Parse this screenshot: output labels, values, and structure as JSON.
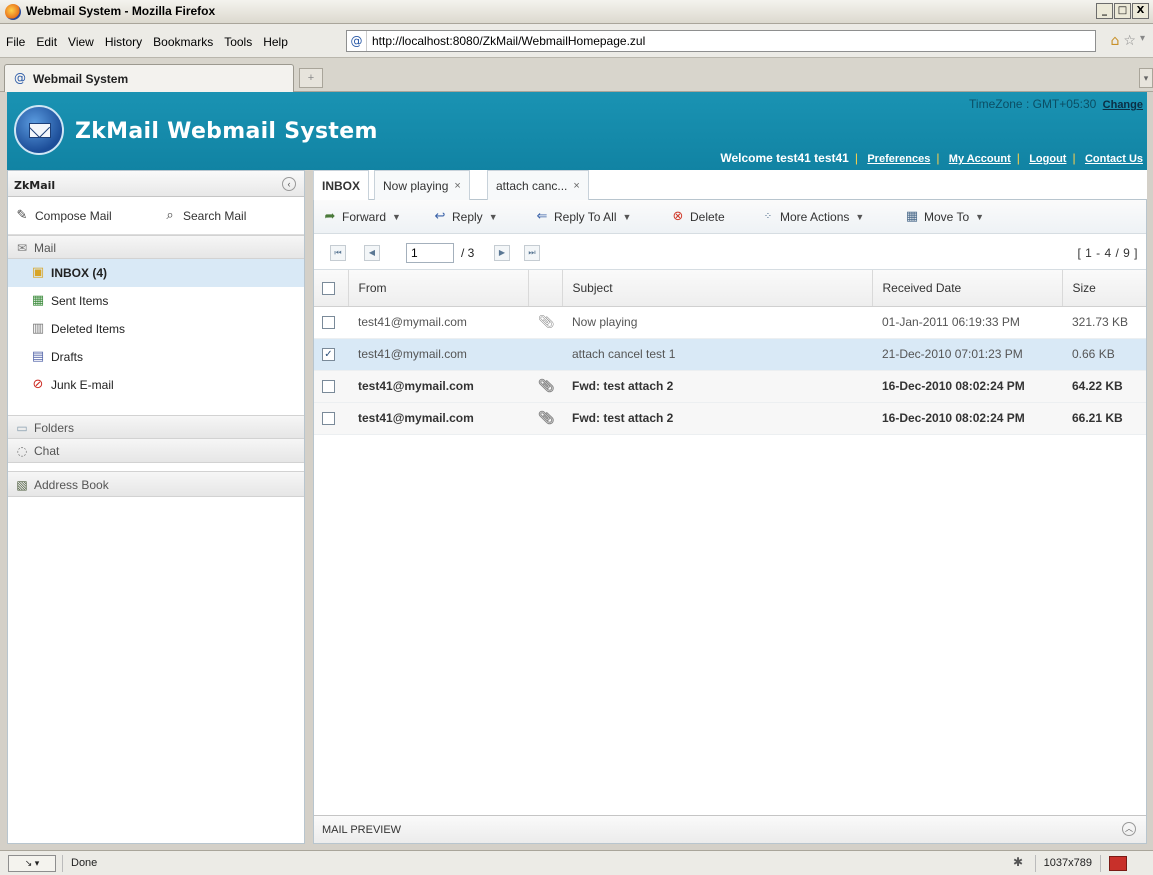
{
  "window": {
    "title": "Webmail System - Mozilla Firefox",
    "controls": [
      "_",
      "□",
      "X"
    ]
  },
  "browser": {
    "menu": [
      "File",
      "Edit",
      "View",
      "History",
      "Bookmarks",
      "Tools",
      "Help"
    ],
    "url": "http://localhost:8080/ZkMail/WebmailHomepage.zul",
    "tab_title": "Webmail System",
    "status": "Done",
    "resolution": "1037x789"
  },
  "app": {
    "title": "ZkMail Webmail System",
    "timezone_label": "TimeZone : GMT+05:30",
    "timezone_change": "Change",
    "welcome": "Welcome test41 test41",
    "links": [
      "Preferences",
      "My Account",
      "Logout",
      "Contact Us"
    ]
  },
  "sidebar": {
    "header": "ZkMail",
    "compose_label": "Compose Mail",
    "search_label": "Search Mail",
    "mail_group": "Mail",
    "folders": [
      {
        "label": "INBOX (4)",
        "icon": "inbox-icon",
        "selected": true
      },
      {
        "label": "Sent Items",
        "icon": "sent-icon"
      },
      {
        "label": "Deleted Items",
        "icon": "trash-icon"
      },
      {
        "label": "Drafts",
        "icon": "drafts-icon"
      },
      {
        "label": "Junk E-mail",
        "icon": "junk-icon"
      }
    ],
    "folders_group": "Folders",
    "chat_group": "Chat",
    "address_book": "Address Book"
  },
  "main": {
    "tabs": [
      {
        "label": "INBOX",
        "closable": false,
        "active": true
      },
      {
        "label": "Now playing",
        "closable": true
      },
      {
        "label": "attach canc...",
        "closable": true
      }
    ],
    "toolbar": {
      "forward": "Forward",
      "reply": "Reply",
      "reply_all": "Reply To All",
      "delete": "Delete",
      "more_actions": "More Actions",
      "move_to": "Move To"
    },
    "pager": {
      "page": "1",
      "total": "/ 3",
      "range": "[ 1 - 4 / 9 ]"
    },
    "columns": [
      "From",
      "Subject",
      "Received Date",
      "Size"
    ],
    "rows": [
      {
        "from": "test41@mymail.com",
        "attachment": true,
        "subject": "Now playing",
        "date": "01-Jan-2011 06:19:33 PM",
        "size": "321.73 KB",
        "checked": false,
        "unread": false,
        "selected": false
      },
      {
        "from": "test41@mymail.com",
        "attachment": false,
        "subject": "attach cancel test 1",
        "date": "21-Dec-2010 07:01:23 PM",
        "size": "0.66 KB",
        "checked": true,
        "unread": false,
        "selected": true
      },
      {
        "from": "test41@mymail.com",
        "attachment": true,
        "subject": "Fwd: test attach 2",
        "date": "16-Dec-2010 08:02:24 PM",
        "size": "64.22 KB",
        "checked": false,
        "unread": true,
        "selected": false
      },
      {
        "from": "test41@mymail.com",
        "attachment": true,
        "subject": "Fwd: test attach 2",
        "date": "16-Dec-2010 08:02:24 PM",
        "size": "66.21 KB",
        "checked": false,
        "unread": true,
        "selected": false
      }
    ],
    "preview_label": "MAIL PREVIEW"
  },
  "colors": {
    "header_bg": "#1a93b3",
    "selection": "#d9e9f6",
    "link_sep": "#ffd24a"
  }
}
